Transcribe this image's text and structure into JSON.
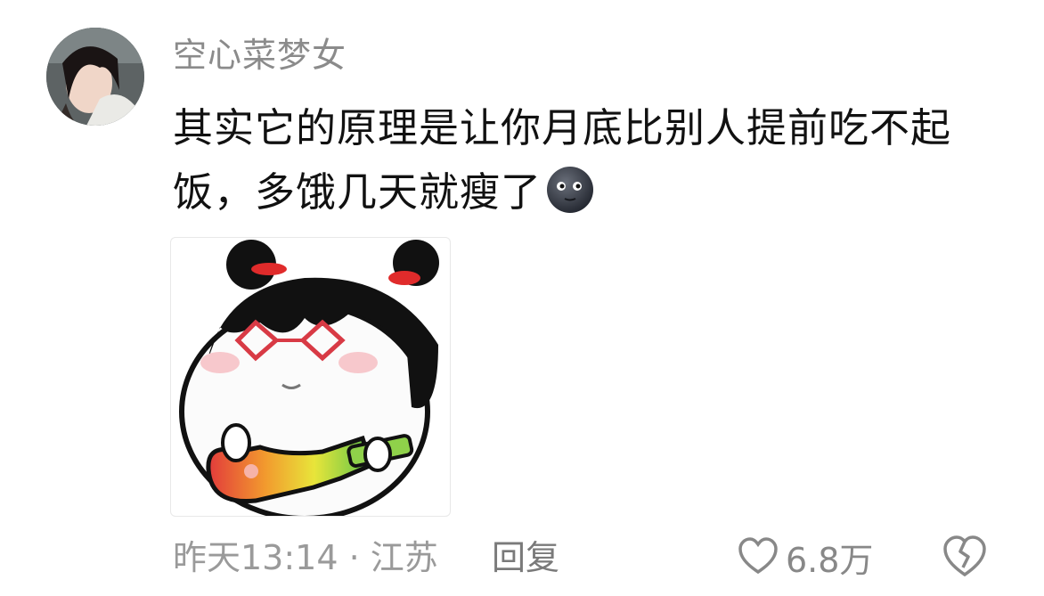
{
  "comment": {
    "username": "空心菜梦女",
    "text": "其实它的原理是让你月底比别人提前吃不起饭，多饿几天就瘦了",
    "emoji_icon": "new-moon-face-icon",
    "sticker_icon": "girl-with-guitar-sticker"
  },
  "meta": {
    "time_location": "昨天13:14 · 江苏",
    "reply_label": "回复",
    "like_count": "6.8万"
  },
  "colors": {
    "username": "#8b8b8b",
    "text": "#111111",
    "meta": "#9a9a9a"
  }
}
